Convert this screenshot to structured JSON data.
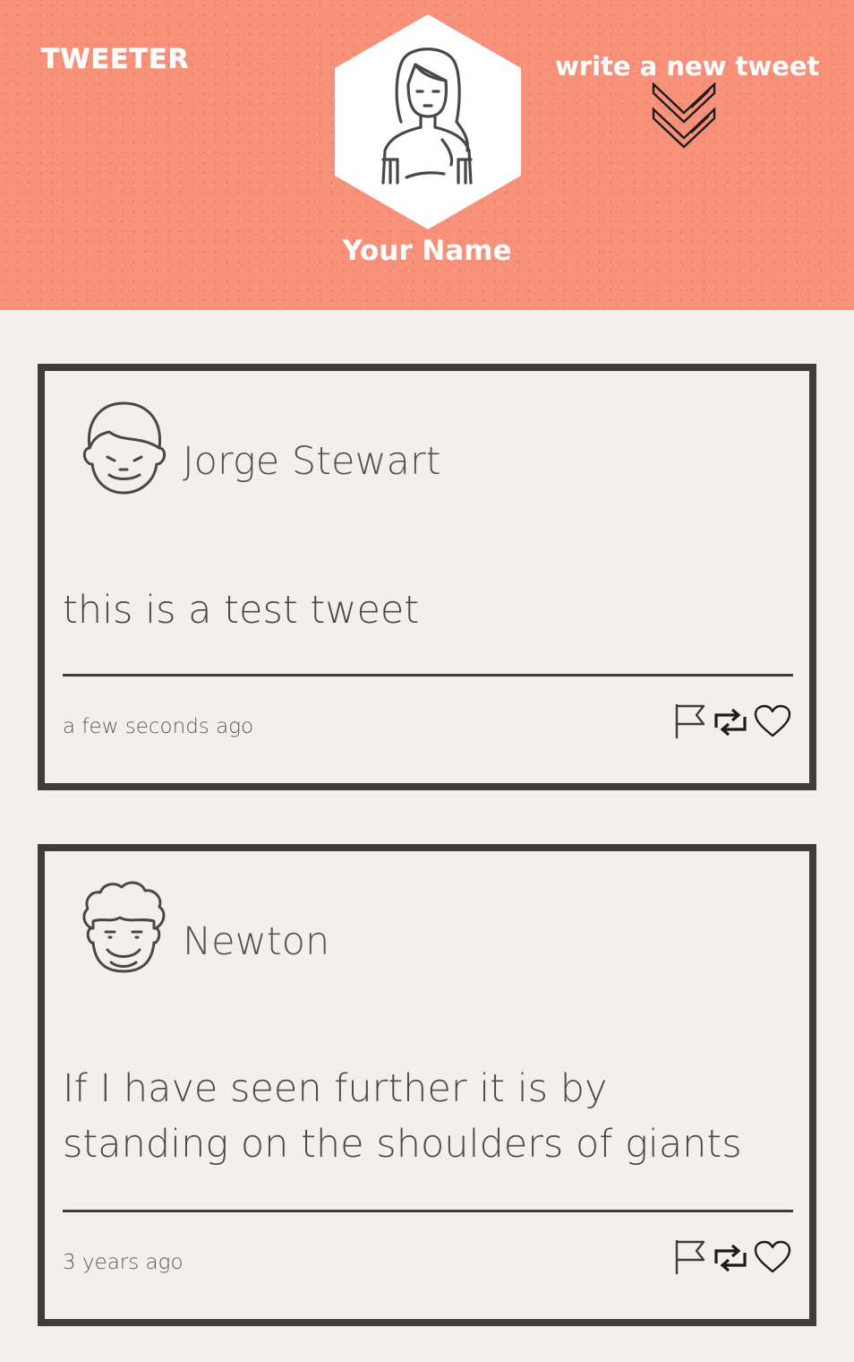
{
  "header": {
    "brand": "TWEETER",
    "user_name": "Your Name",
    "compose_label": "write a new tweet",
    "compose_icon": "double-chevron-down-icon",
    "profile_icon": "user-avatar-icon"
  },
  "colors": {
    "header_bg": "#f8917a",
    "page_bg": "#f3f0ec",
    "border": "#3f3d3c"
  },
  "tweets": [
    {
      "author": "Jorge Stewart",
      "text": "this is a test tweet",
      "time": "a few seconds ago",
      "actions": [
        "flag-icon",
        "retweet-icon",
        "heart-icon"
      ]
    },
    {
      "author": "Newton",
      "text": "If I have seen further it is by standing on the shoulders of giants",
      "time": "3 years ago",
      "actions": [
        "flag-icon",
        "retweet-icon",
        "heart-icon"
      ]
    }
  ]
}
